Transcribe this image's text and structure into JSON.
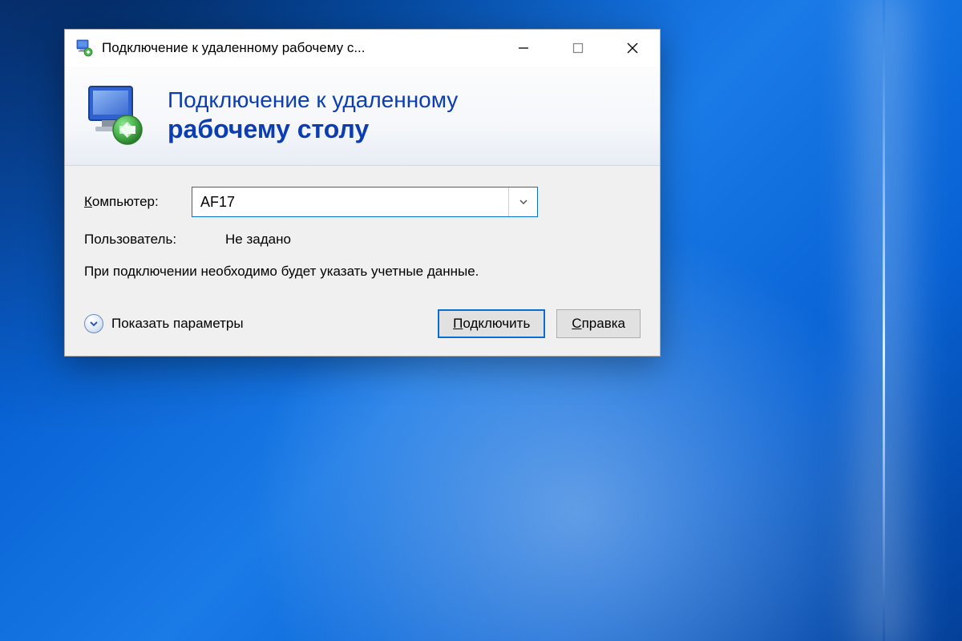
{
  "window": {
    "title": "Подключение к удаленному рабочему с..."
  },
  "header": {
    "line1": "Подключение к удаленному",
    "line2": "рабочему столу"
  },
  "form": {
    "computer_label": "Компьютер:",
    "computer_value": "AF17",
    "user_label": "Пользователь:",
    "user_value": "Не задано",
    "hint": "При подключении необходимо будет указать учетные данные."
  },
  "footer": {
    "show_options": "Показать параметры",
    "connect": "Подключить",
    "help_prefix": "С",
    "help_rest": "правка"
  }
}
